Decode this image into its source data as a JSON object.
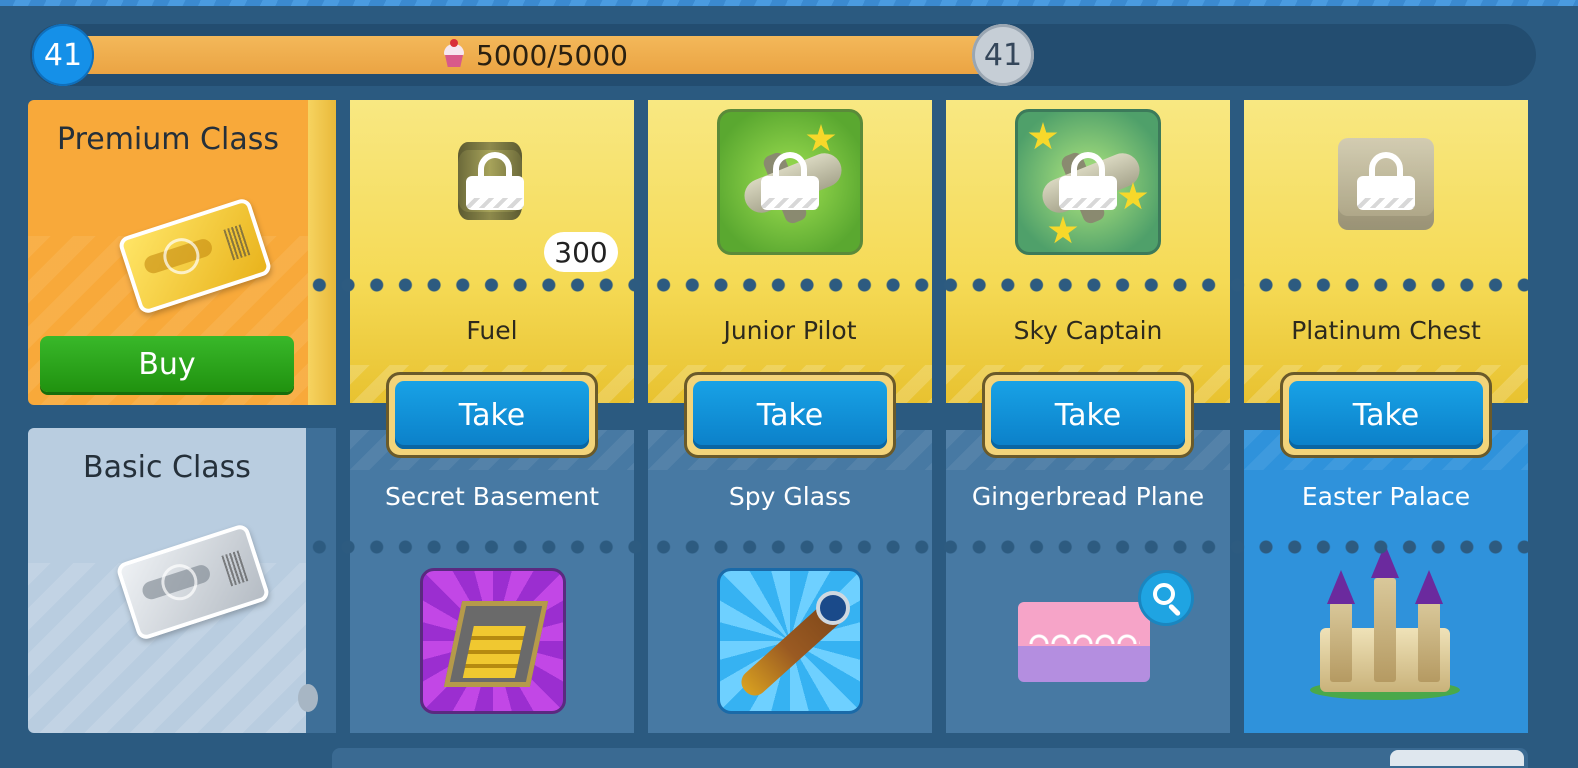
{
  "progress": {
    "level_current": "41",
    "level_next": "41",
    "value_text": "5000/5000",
    "fraction": 1.0,
    "currency_icon": "cupcake-icon"
  },
  "classes": {
    "premium": {
      "title": "Premium Class",
      "buy_label": "Buy",
      "icon": "gold-ticket-icon"
    },
    "basic": {
      "title": "Basic Class",
      "icon": "silver-ticket-icon"
    }
  },
  "rewards": [
    {
      "premium_name": "Fuel",
      "premium_locked": true,
      "premium_count": "300",
      "take_label": "Take",
      "basic_name": "Secret Basement"
    },
    {
      "premium_name": "Junior Pilot",
      "premium_locked": true,
      "take_label": "Take",
      "basic_name": "Spy Glass"
    },
    {
      "premium_name": "Sky Captain",
      "premium_locked": true,
      "take_label": "Take",
      "basic_name": "Gingerbread Plane"
    },
    {
      "premium_name": "Platinum Chest",
      "premium_locked": true,
      "take_label": "Take",
      "basic_name": "Easter Palace"
    }
  ],
  "colors": {
    "premium_panel": "#f8a93a",
    "premium_cell": "#f5da55",
    "basic_panel": "#b9cde0",
    "basic_cell": "#4779a3",
    "take_button": "#0b7fc8",
    "buy_button": "#20920f"
  }
}
